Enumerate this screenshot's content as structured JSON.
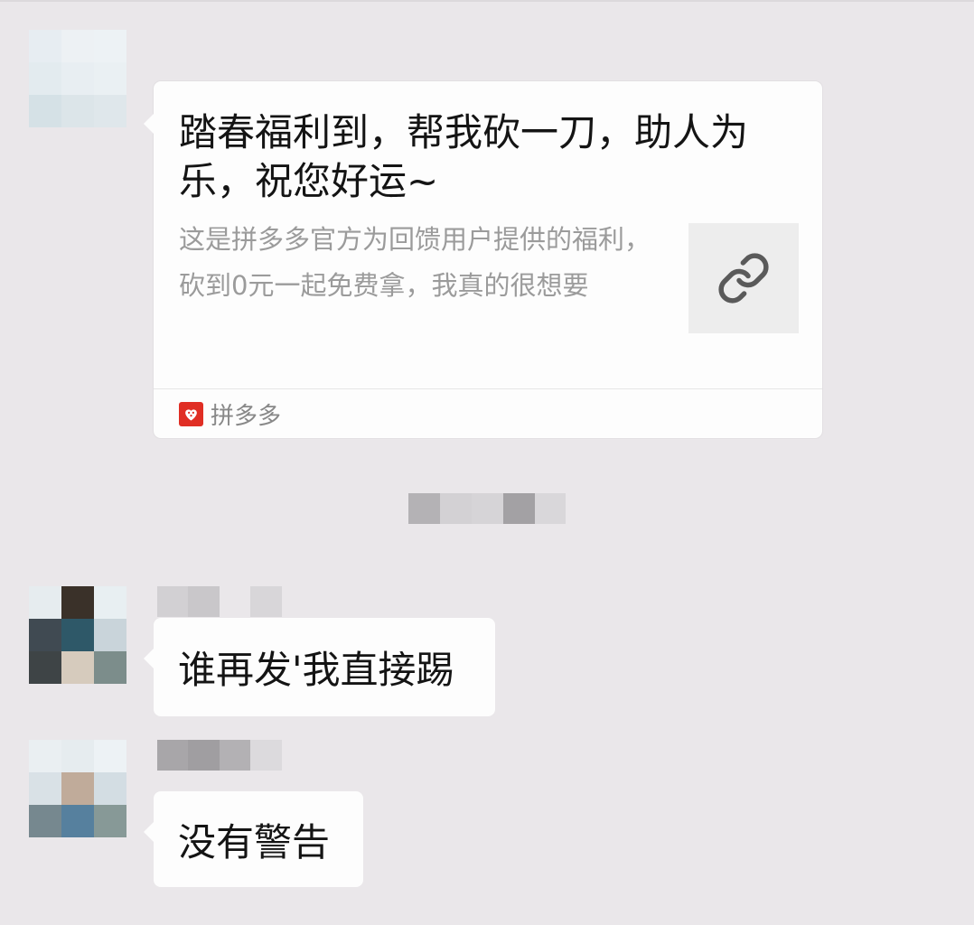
{
  "messages": {
    "card": {
      "title": "踏春福利到，帮我砍一刀，助人为乐，祝您好运~",
      "description": "这是拼多多官方为回馈用户提供的福利，砍到0元一起免费拿，我真的很想要",
      "thumbnail_icon": "link-icon",
      "source_icon": "pinduoduo-logo-icon",
      "source_name": "拼多多"
    },
    "reply_1": {
      "text": "谁再发'我直接踢"
    },
    "reply_2": {
      "text": "没有警告"
    }
  },
  "colors": {
    "background": "#eae7ea",
    "bubble": "#fdfdfd",
    "text_primary": "#141414",
    "text_secondary": "#9b9b9b",
    "brand_red": "#e02e24"
  }
}
